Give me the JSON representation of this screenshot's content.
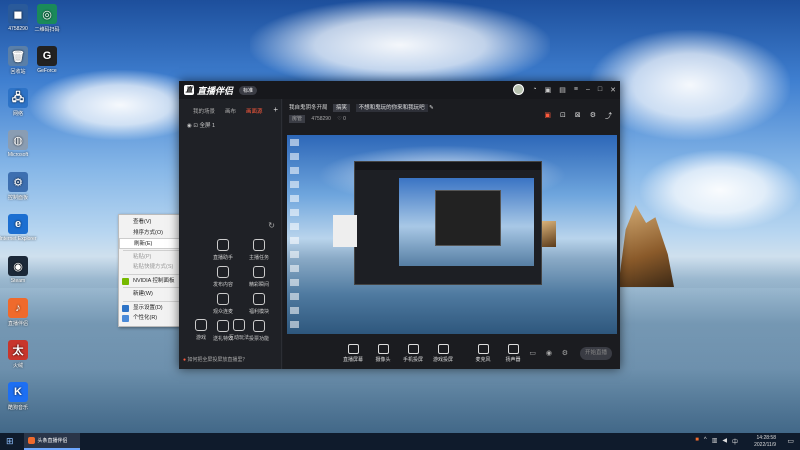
{
  "desktop": {
    "icons": [
      {
        "label": "4758290",
        "glyph": "◼",
        "color": "#2a5a9a"
      },
      {
        "label": "回收站",
        "glyph": "🗑",
        "color": "#5a7fa8"
      },
      {
        "label": "网络",
        "glyph": "🖧",
        "color": "#2d73c7"
      },
      {
        "label": "Microsoft",
        "glyph": "◍",
        "color": "#8a9db3"
      },
      {
        "label": "控制面板",
        "glyph": "⚙",
        "color": "#3d6fb0"
      },
      {
        "label": "Internet Explorer",
        "glyph": "e",
        "color": "#1c6fd1"
      },
      {
        "label": "Steam",
        "glyph": "◉",
        "color": "#1b2838"
      },
      {
        "label": "直播伴侣",
        "glyph": "♪",
        "color": "#ef6a2c"
      },
      {
        "label": "火绒",
        "glyph": "太",
        "color": "#c8362c"
      },
      {
        "label": "酷狗音乐",
        "glyph": "K",
        "color": "#1d6ff2"
      }
    ],
    "icons_col2": [
      {
        "label": "二维码扫码",
        "glyph": "◎",
        "color": "#1a8a5a"
      },
      {
        "label": "GeForce",
        "glyph": "G",
        "color": "#222"
      }
    ]
  },
  "context_menu": {
    "items": [
      {
        "label": "查看(V)",
        "arrow": "›",
        "disabled": false
      },
      {
        "label": "排序方式(O)",
        "arrow": "›",
        "disabled": false
      },
      {
        "label": "刷新(E)",
        "arrow": "",
        "disabled": false,
        "highlight": true
      },
      {
        "label": "粘贴(P)",
        "arrow": "",
        "disabled": true
      },
      {
        "label": "粘贴快捷方式(S)",
        "arrow": "",
        "disabled": true
      },
      {
        "label": "NVIDIA 控制面板",
        "arrow": "",
        "disabled": false
      },
      {
        "label": "新建(W)",
        "arrow": "›",
        "disabled": false
      },
      {
        "label": "显示设置(D)",
        "arrow": "",
        "disabled": false
      },
      {
        "label": "个性化(R)",
        "arrow": "",
        "disabled": false
      }
    ]
  },
  "app": {
    "title": "直播伴侣",
    "version": "标准",
    "left_tabs": [
      "我的场景",
      "画布",
      "画面源"
    ],
    "scene_label": "全屏 1",
    "tools": [
      "直播助手",
      "主播任务",
      "发布内容",
      "精彩瞬间",
      "观众连麦",
      "福利模块",
      "送礼特效",
      "投票功能",
      "游戏",
      "互动玩法"
    ],
    "notice": "如何把全屏投屏放直播里？",
    "info_title": "我自鬼阴冬开局",
    "info_tag": "搞笑",
    "info_subtitle": "不想和鬼玩的你来和我玩吧",
    "info_id": "4758290",
    "info_followers": "0",
    "bottom_buttons": [
      "直播屏幕",
      "摄像头",
      "手机投屏",
      "游戏投屏",
      "麦克风",
      "扬声器"
    ],
    "go_live": "开始直播"
  },
  "taskbar": {
    "app_label": "头条直播伴侣",
    "time": "14:28:58",
    "date": "2022/11/9"
  }
}
